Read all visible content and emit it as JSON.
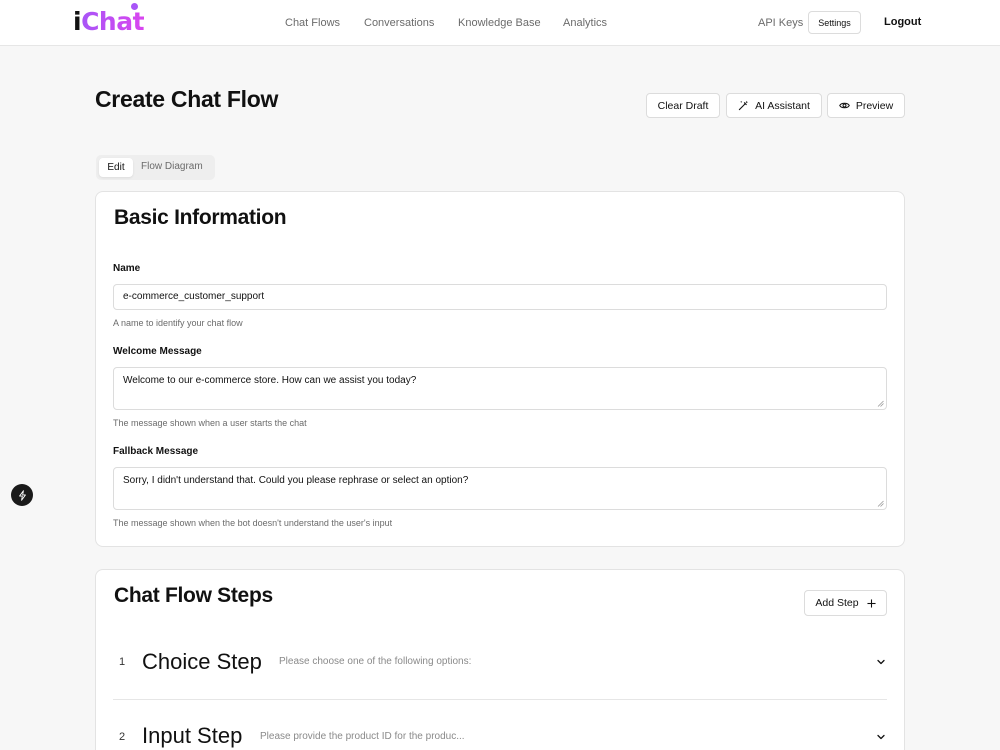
{
  "app": {
    "logo_i": "i",
    "logo_chat": "Chat",
    "nav": [
      "Chat Flows",
      "Conversations",
      "Knowledge Base",
      "Analytics"
    ],
    "api_keys": "API Keys",
    "settings": "Settings",
    "logout": "Logout"
  },
  "page": {
    "title": "Create Chat Flow",
    "buttons": {
      "clear_draft": "Clear Draft",
      "ai_assistant": "AI Assistant",
      "preview": "Preview"
    },
    "tabs": {
      "edit": "Edit",
      "flow_diagram": "Flow Diagram"
    }
  },
  "basic_info": {
    "title": "Basic Information",
    "name": {
      "label": "Name",
      "value": "e-commerce_customer_support",
      "help": "A name to identify your chat flow"
    },
    "welcome": {
      "label": "Welcome Message",
      "value": "Welcome to our e-commerce store. How can we assist you today?",
      "help": "The message shown when a user starts the chat"
    },
    "fallback": {
      "label": "Fallback Message",
      "value": "Sorry, I didn't understand that. Could you please rephrase or select an option?",
      "help": "The message shown when the bot doesn't understand the user's input"
    }
  },
  "steps": {
    "title": "Chat Flow Steps",
    "add_step": "Add Step",
    "items": [
      {
        "num": "1",
        "title": "Choice Step",
        "desc": "Please choose one of the following options:"
      },
      {
        "num": "2",
        "title": "Input Step",
        "desc": "Please provide the product ID for the produc..."
      }
    ]
  },
  "icons": {
    "ai_assistant": "magic-wand-icon",
    "preview": "eye-icon",
    "add_step": "plus-icon",
    "step_toggle": "chevron-down-icon",
    "floating": "lightning-icon"
  },
  "colors": {
    "brand_purple": "#a855f7",
    "brand_pink": "#d946ef"
  }
}
